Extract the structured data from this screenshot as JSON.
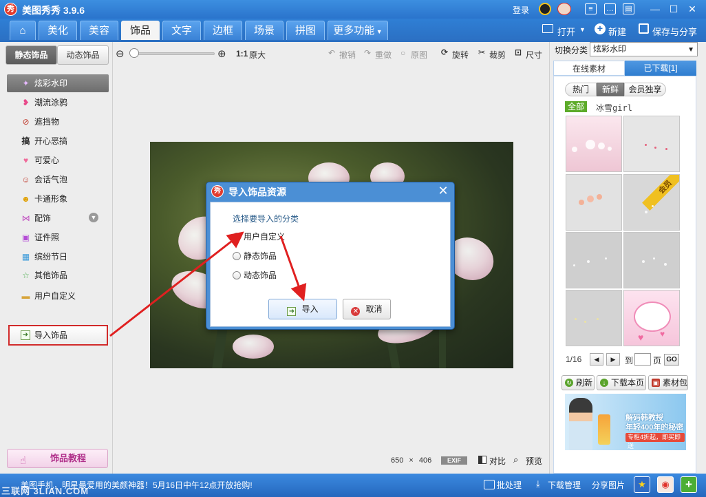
{
  "app": {
    "logo": "秀",
    "title": "美图秀秀 3.9.6",
    "login": "登录",
    "window_controls": [
      "minimize-icon",
      "maximize-icon",
      "close-icon"
    ]
  },
  "tabs": [
    {
      "label": "美化"
    },
    {
      "label": "美容"
    },
    {
      "label": "饰品"
    },
    {
      "label": "文字"
    },
    {
      "label": "边框"
    },
    {
      "label": "场景"
    },
    {
      "label": "拼图"
    },
    {
      "label": "更多功能"
    }
  ],
  "active_tab": "饰品",
  "toolbar_right": {
    "open": "打开",
    "new": "新建",
    "save_share": "保存与分享"
  },
  "left_panel": {
    "subtabs": {
      "static": "静态饰品",
      "dynamic": "动态饰品"
    },
    "categories": [
      {
        "label": "炫彩水印",
        "icon": "sparkle-icon",
        "selected": true
      },
      {
        "label": "潮流涂鸦",
        "icon": "lips-icon"
      },
      {
        "label": "遮挡物",
        "icon": "mask-icon"
      },
      {
        "label": "开心恶搞",
        "icon": "gao-icon"
      },
      {
        "label": "可爱心",
        "icon": "heart-icon"
      },
      {
        "label": "会话气泡",
        "icon": "bubble-icon"
      },
      {
        "label": "卡通形象",
        "icon": "cartoon-icon"
      },
      {
        "label": "配饰",
        "icon": "bow-icon"
      },
      {
        "label": "证件照",
        "icon": "shirt-icon"
      },
      {
        "label": "缤纷节日",
        "icon": "gift-icon"
      },
      {
        "label": "其他饰品",
        "icon": "star-icon"
      },
      {
        "label": "用户自定义",
        "icon": "folder-icon"
      }
    ],
    "import_button": "导入饰品",
    "tutorial_button": "饰品教程"
  },
  "canvas_toolbar": {
    "zoom_ratio": "1:1",
    "original_size": "原大",
    "undo": "撤销",
    "redo": "重做",
    "original": "原图",
    "rotate": "旋转",
    "crop": "裁剪",
    "size": "尺寸"
  },
  "canvas_footer": {
    "width": "650",
    "times": "×",
    "height": "406",
    "exif": "EXIF",
    "compare": "对比",
    "preview": "预览"
  },
  "dialog": {
    "title": "导入饰品资源",
    "prompt": "选择要导入的分类",
    "options": [
      {
        "label": "用户自定义",
        "checked": true
      },
      {
        "label": "静态饰品",
        "checked": false
      },
      {
        "label": "动态饰品",
        "checked": false
      }
    ],
    "import_button": "导入",
    "cancel_button": "取消"
  },
  "right_panel": {
    "switch_label": "切换分类",
    "switch_value": "炫彩水印",
    "source_tabs": {
      "online": "在线素材",
      "downloaded": "已下载[1]"
    },
    "filters": {
      "hot": "热门",
      "new": "新鲜",
      "vip": "会员独享"
    },
    "filter_all": "全部",
    "filter_name": "冰雪girl",
    "vip_badge": "会员",
    "pager": {
      "current": "1/16",
      "to": "到",
      "page": "页",
      "go": "GO"
    },
    "actions": {
      "refresh": "刷新",
      "download_page": "下载本页",
      "package": "素材包"
    },
    "ad": {
      "line1": "解码韩教授",
      "line2": "年轻400年的秘密",
      "line3": "专柜4折起，即买即送"
    }
  },
  "statusbar": {
    "text": "美图手机，明星最爱用的美颜神器！5月16日中午12点开放抢购!",
    "watermark": "三联网 3LIAN.COM",
    "batch": "批处理",
    "download_manager": "下载管理",
    "share_image": "分享图片"
  },
  "colors": {
    "title_blue": "#2a74cc",
    "highlight_red": "#d12a2a",
    "dialog_blue": "#4b8fd5",
    "downloaded_tab": "#2f7dcf"
  }
}
